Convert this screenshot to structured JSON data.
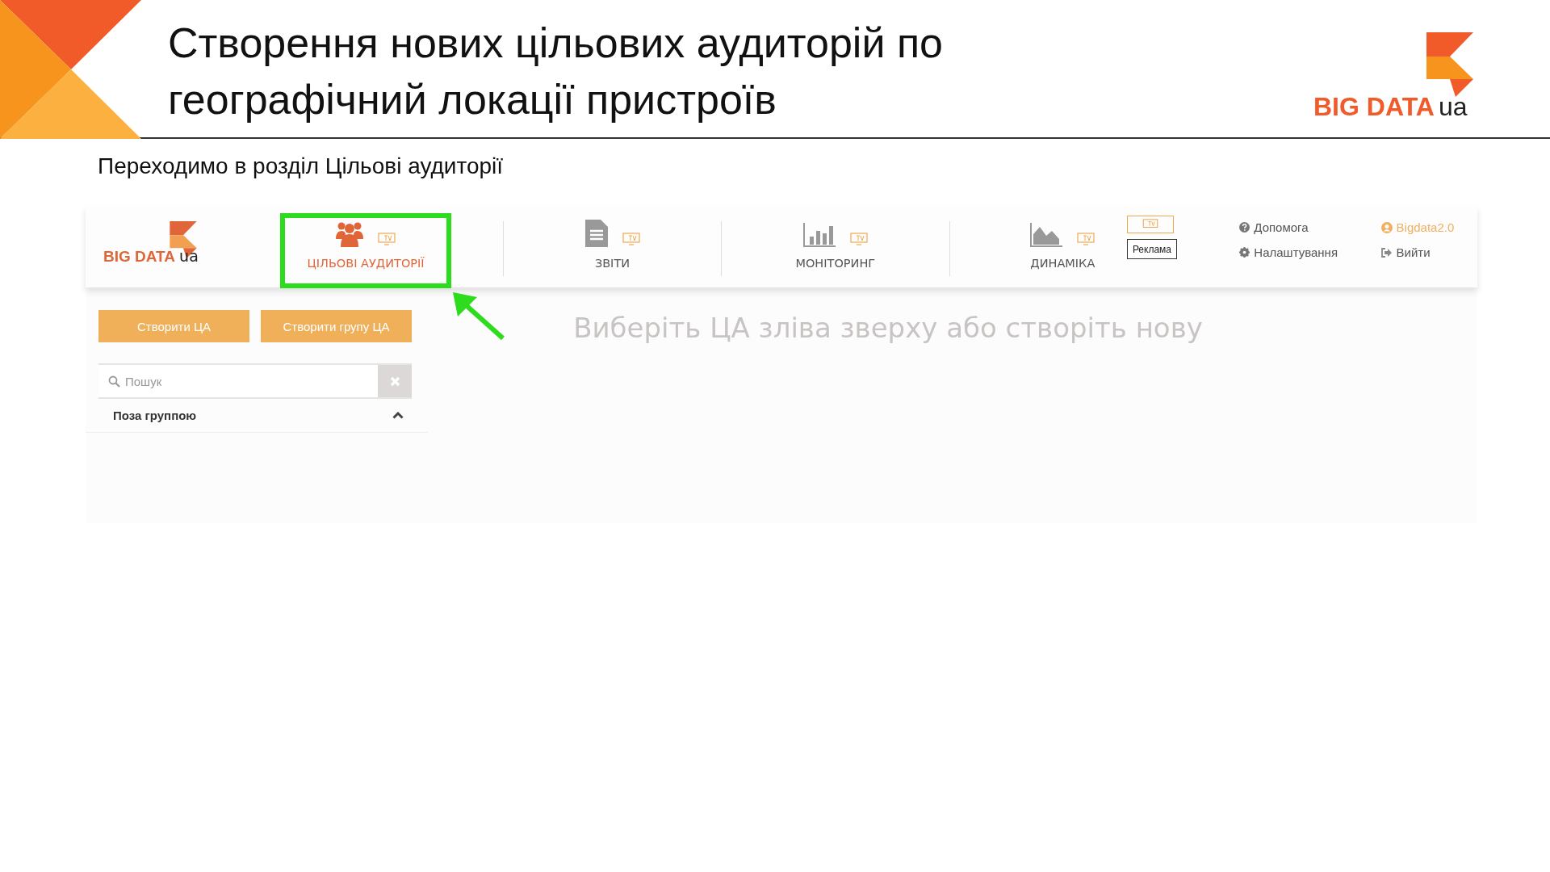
{
  "slide": {
    "title_lines": [
      "Створення нових цільових аудиторій по",
      "географічний локації пристроїв"
    ],
    "logo": {
      "brand": "BIG DATA",
      "suffix": "ua"
    },
    "subtitle": "Переходимо в розділ Цільові аудиторії"
  },
  "app": {
    "logo": {
      "brand": "BIG DATA",
      "suffix": "ua"
    },
    "tabs": [
      {
        "kind": "audiences",
        "label": "ЦІЛЬОВІ АУДИТОРІЇ",
        "selected": true,
        "highlighted": true
      },
      {
        "kind": "reports",
        "label": "ЗВІТИ",
        "selected": false,
        "highlighted": false
      },
      {
        "kind": "monitoring",
        "label": "МОНІТОРИНГ",
        "selected": false,
        "highlighted": false
      },
      {
        "kind": "dynamics",
        "label": "ДИНАМІКА",
        "selected": false,
        "highlighted": false
      }
    ],
    "ad_button": "Реклама",
    "links": [
      {
        "kind": "help",
        "label": "Допомога"
      },
      {
        "kind": "settings",
        "label": "Налаштування"
      }
    ],
    "user": {
      "name": "Bigdata2.0",
      "logout": "Вийти"
    },
    "buttons": [
      "Створити ЦА",
      "Створити групу ЦА"
    ],
    "search": {
      "placeholder": "Пошук"
    },
    "groups": [
      {
        "label": "Поза группою",
        "expanded": true
      }
    ],
    "empty_message": "Виберіть ЦА зліва зверху або створіть нову"
  }
}
